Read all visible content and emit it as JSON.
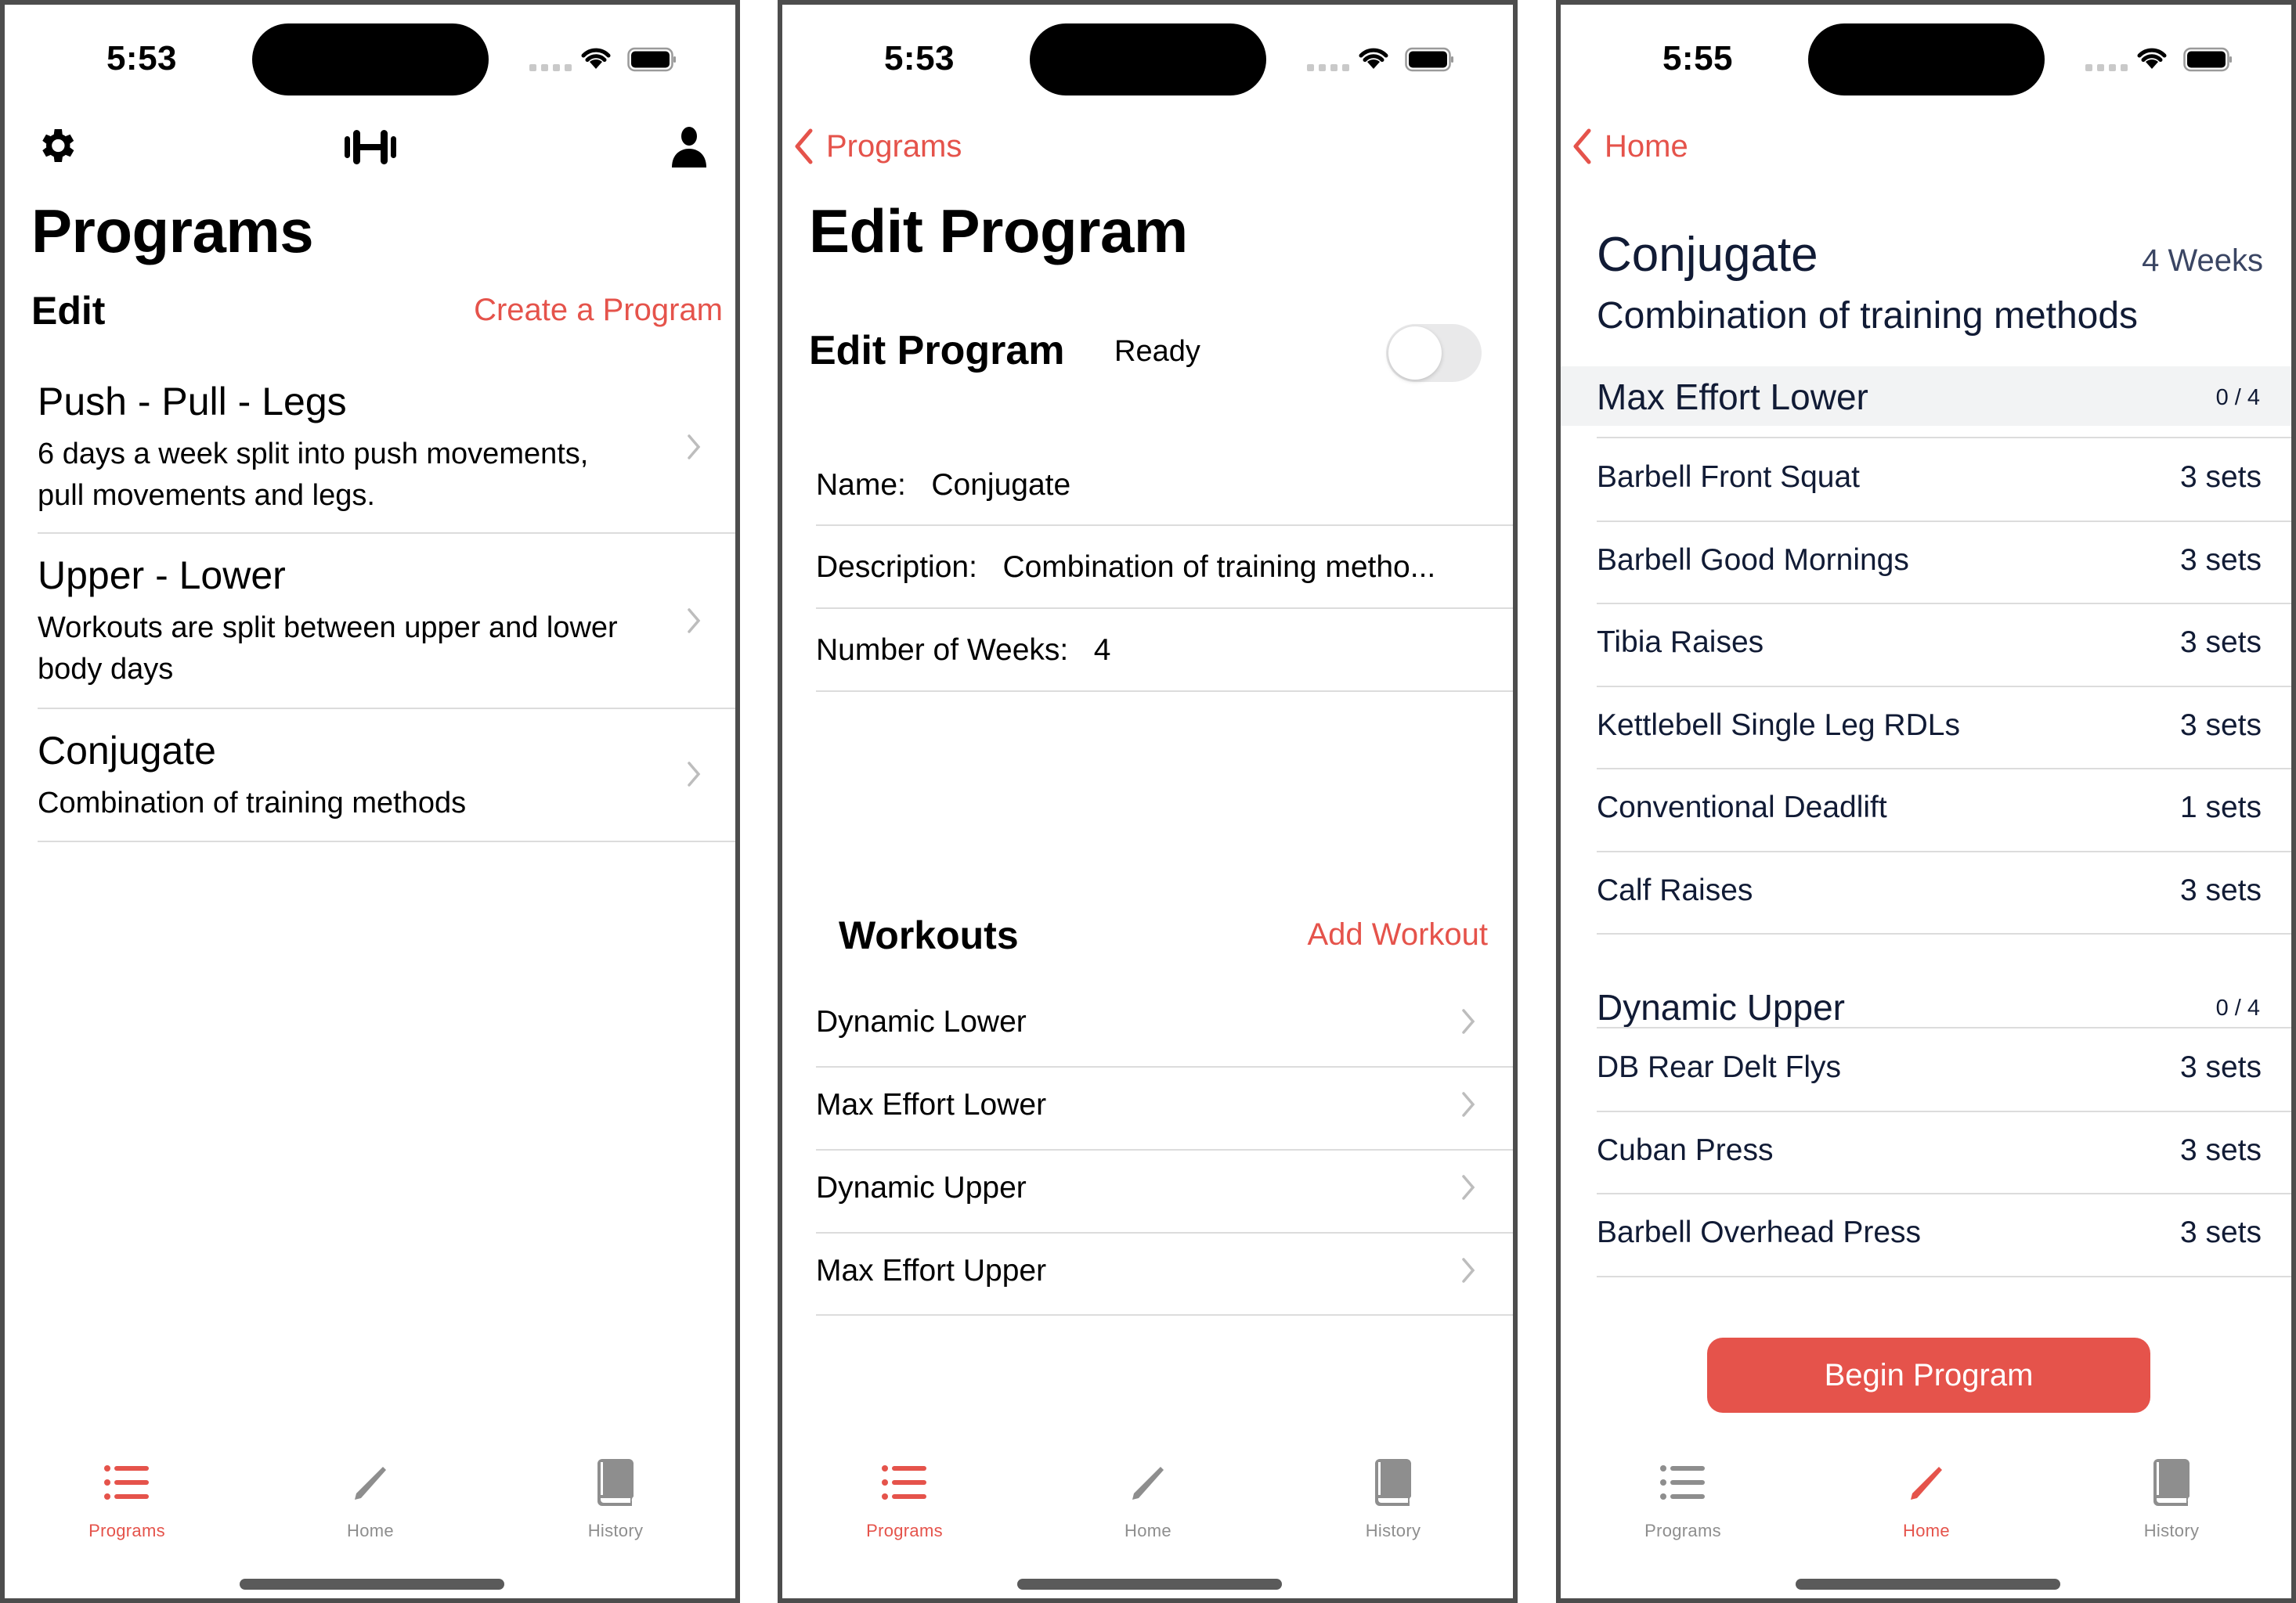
{
  "colors": {
    "accent": "#e5534b",
    "navy_text": "#111b35",
    "tab_inactive": "#8e8e8e",
    "separator": "#dcdcdc"
  },
  "tab_bar": {
    "items": [
      {
        "label": "Programs",
        "icon": "list-bullet-icon"
      },
      {
        "label": "Home",
        "icon": "pencil-icon"
      },
      {
        "label": "History",
        "icon": "book-icon"
      }
    ]
  },
  "screens": {
    "programs": {
      "status_time": "5:53",
      "toolbar_icons": [
        "gear-icon",
        "dumbbell-icon",
        "person-icon"
      ],
      "title": "Programs",
      "edit_label": "Edit",
      "create_label": "Create a Program",
      "items": [
        {
          "title": "Push - Pull - Legs",
          "subtitle_lines": [
            "6 days a week split into push movements,",
            "pull movements and legs."
          ]
        },
        {
          "title": "Upper - Lower",
          "subtitle_lines": [
            "Workouts are split between upper and lower",
            "body days"
          ]
        },
        {
          "title": "Conjugate",
          "subtitle_lines": [
            "Combination of training methods"
          ]
        }
      ],
      "active_tab": "Programs"
    },
    "edit_program": {
      "status_time": "5:53",
      "back_label": "Programs",
      "title": "Edit Program",
      "section_title": "Edit Program",
      "ready_label": "Ready",
      "ready_toggle_on": false,
      "fields": [
        {
          "label": "Name:",
          "value": "Conjugate"
        },
        {
          "label": "Description:",
          "value": "Combination of training metho..."
        },
        {
          "label": "Number of Weeks:",
          "value": "4"
        }
      ],
      "workouts_title": "Workouts",
      "add_workout_label": "Add Workout",
      "workouts": [
        "Dynamic Lower",
        "Max Effort Lower",
        "Dynamic Upper",
        "Max Effort Upper"
      ],
      "active_tab": "Programs"
    },
    "program_detail": {
      "status_time": "5:55",
      "back_label": "Home",
      "program_name": "Conjugate",
      "weeks_label": "4 Weeks",
      "description": "Combination of training methods",
      "sections": [
        {
          "name": "Max Effort Lower",
          "progress": "0 / 4",
          "exercises": [
            {
              "name": "Barbell Front Squat",
              "sets": "3 sets"
            },
            {
              "name": "Barbell Good Mornings",
              "sets": "3 sets"
            },
            {
              "name": "Tibia Raises",
              "sets": "3 sets"
            },
            {
              "name": "Kettlebell Single Leg RDLs",
              "sets": "3 sets"
            },
            {
              "name": "Conventional Deadlift",
              "sets": "1 sets"
            },
            {
              "name": "Calf Raises",
              "sets": "3 sets"
            }
          ]
        },
        {
          "name": "Dynamic Upper",
          "progress": "0 / 4",
          "exercises": [
            {
              "name": "DB Rear Delt Flys",
              "sets": "3 sets"
            },
            {
              "name": "Cuban Press",
              "sets": "3 sets"
            },
            {
              "name": "Barbell Overhead Press",
              "sets": "3 sets"
            }
          ]
        }
      ],
      "begin_label": "Begin Program",
      "active_tab": "Home"
    }
  }
}
